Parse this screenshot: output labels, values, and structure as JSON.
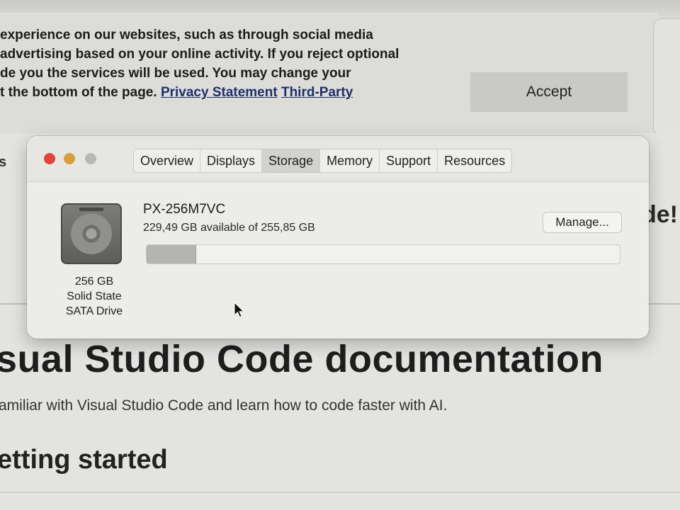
{
  "cookie_banner": {
    "lines": [
      "experience on our websites, such as through social media",
      "advertising based on your online activity. If you reject optional",
      "de you the services will be used. You may change your",
      "t the bottom of the page."
    ],
    "privacy_link": "Privacy Statement",
    "third_party_link": "Third-Party",
    "accept_label": "Accept"
  },
  "page": {
    "left_fragment": "s",
    "right_fragment": "de!",
    "heading": "sual Studio Code documentation",
    "subtitle": "amiliar with Visual Studio Code and learn how to code faster with AI.",
    "section_heading": "etting started"
  },
  "window": {
    "tabs": [
      {
        "label": "Overview",
        "active": false
      },
      {
        "label": "Displays",
        "active": false
      },
      {
        "label": "Storage",
        "active": true
      },
      {
        "label": "Memory",
        "active": false
      },
      {
        "label": "Support",
        "active": false
      },
      {
        "label": "Resources",
        "active": false
      }
    ],
    "drive": {
      "name": "PX-256M7VC",
      "availability": "229,49 GB available of 255,85 GB",
      "caption": [
        "256 GB",
        "Solid State",
        "SATA Drive"
      ],
      "used_fraction": 0.103,
      "manage_label": "Manage..."
    }
  },
  "colors": {
    "close": "#e0443a",
    "minimize": "#d9a03a",
    "zoom": "#b8b8b5",
    "link": "#1f2f6b"
  },
  "icons": {
    "drive": "hard-drive-icon",
    "cursor": "arrow-cursor-icon"
  }
}
